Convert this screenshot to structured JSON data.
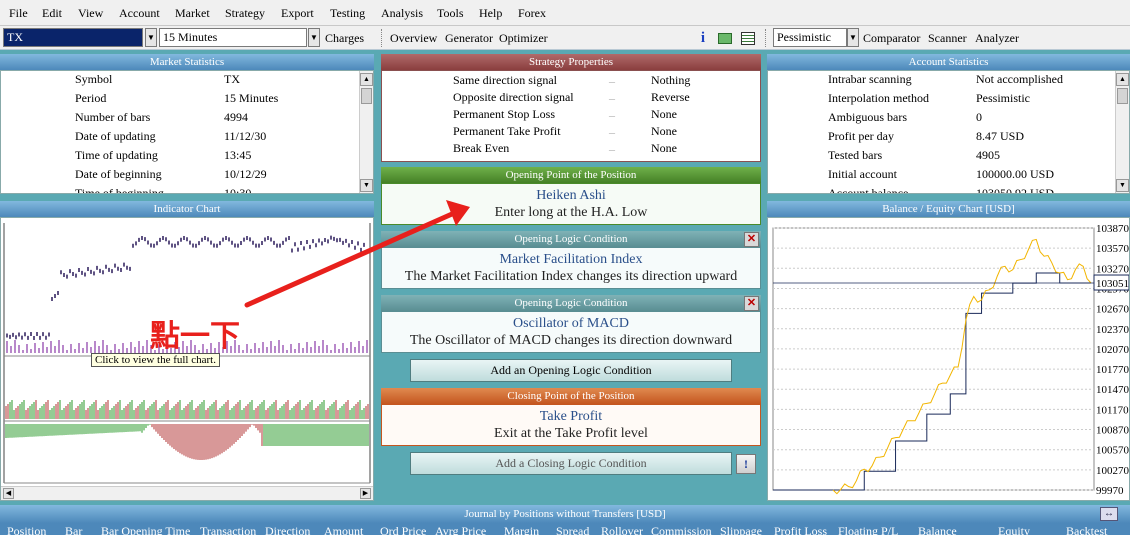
{
  "menu": [
    "File",
    "Edit",
    "View",
    "Account",
    "Market",
    "Strategy",
    "Export",
    "Testing",
    "Analysis",
    "Tools",
    "Help",
    "Forex"
  ],
  "toolbar": {
    "symbol": "TX",
    "period": "15 Minutes",
    "charges": "Charges",
    "overview": "Overview",
    "generator": "Generator",
    "optimizer": "Optimizer",
    "interpolation": "Pessimistic",
    "comparator": "Comparator",
    "scanner": "Scanner",
    "analyzer": "Analyzer"
  },
  "market_statistics": {
    "title": "Market Statistics",
    "rows": [
      {
        "label": "Symbol",
        "value": "TX"
      },
      {
        "label": "Period",
        "value": "15 Minutes"
      },
      {
        "label": "Number of bars",
        "value": "4994"
      },
      {
        "label": "Date of updating",
        "value": "11/12/30"
      },
      {
        "label": "Time of updating",
        "value": "13:45"
      },
      {
        "label": "Date of beginning",
        "value": "10/12/29"
      },
      {
        "label": "Time of beginning",
        "value": "10:30"
      }
    ]
  },
  "strategy_properties": {
    "title": "Strategy Properties",
    "dash": "_",
    "rows": [
      {
        "label": "Same direction signal",
        "value": "Nothing"
      },
      {
        "label": "Opposite direction signal",
        "value": "Reverse"
      },
      {
        "label": "Permanent Stop Loss",
        "value": "None"
      },
      {
        "label": "Permanent Take Profit",
        "value": "None"
      },
      {
        "label": "Break Even",
        "value": "None"
      }
    ]
  },
  "account_statistics": {
    "title": "Account Statistics",
    "rows": [
      {
        "label": "Intrabar scanning",
        "value": "Not accomplished"
      },
      {
        "label": "Interpolation method",
        "value": "Pessimistic"
      },
      {
        "label": "Ambiguous bars",
        "value": "0"
      },
      {
        "label": "Profit per day",
        "value": "8.47 USD"
      },
      {
        "label": "Tested bars",
        "value": "4905"
      },
      {
        "label": "Initial account",
        "value": "100000.00 USD"
      },
      {
        "label": "Account balance",
        "value": "103050.92 USD"
      }
    ]
  },
  "indicator_chart": {
    "title": "Indicator Chart",
    "tooltip": "Click to view the full chart."
  },
  "opening_point": {
    "title": "Opening Point of the Position",
    "name": "Heiken Ashi",
    "desc": "Enter long at the H.A. Low"
  },
  "opening_logic_1": {
    "title": "Opening Logic Condition",
    "name": "Market Facilitation Index",
    "desc": "The Market Facilitation Index changes its direction upward"
  },
  "opening_logic_2": {
    "title": "Opening Logic Condition",
    "name": "Oscillator of MACD",
    "desc": "The Oscillator of MACD changes its direction downward"
  },
  "add_opening": "Add an Opening Logic Condition",
  "closing_point": {
    "title": "Closing Point of the Position",
    "name": "Take Profit",
    "desc": "Exit at the Take Profit level"
  },
  "add_closing": "Add a Closing Logic Condition",
  "help_glyph": "!",
  "close_glyph": "✕",
  "annotation": {
    "text": "點一下",
    "color": "#e8201c"
  },
  "balance_chart": {
    "title": "Balance / Equity Chart [USD]",
    "current_value": "103051"
  },
  "chart_data": {
    "type": "line",
    "title": "Balance / Equity Chart [USD]",
    "y_ticks": [
      103870,
      103570,
      103270,
      102970,
      102670,
      102370,
      102070,
      101770,
      101470,
      101170,
      100870,
      100570,
      100270,
      99970
    ],
    "ylim": [
      99970,
      103870
    ],
    "marker_value": 103051,
    "series": [
      {
        "color": "#f2b500",
        "values": [
          99970,
          99980,
          100020,
          100110,
          100280,
          100330,
          100460,
          100600,
          100750,
          100880,
          101000,
          101120,
          101260,
          101400,
          101560,
          101680,
          101800,
          102500,
          102850,
          102800,
          102950,
          103150,
          103300,
          103250,
          103400,
          103550,
          103700,
          103450,
          103350,
          103200,
          103100,
          103250,
          103300,
          103051
        ]
      },
      {
        "color": "#1a2a5a",
        "values": [
          99970,
          99970,
          99970,
          99970,
          100250,
          100250,
          100250,
          100250,
          100700,
          100700,
          100700,
          100700,
          101100,
          101100,
          101100,
          101400,
          101400,
          102600,
          102600,
          102900,
          102900,
          102900,
          102900,
          103050,
          103050,
          103050,
          103200,
          103200,
          103200,
          103051,
          103051,
          103051,
          103051,
          103051
        ]
      }
    ]
  },
  "journal": {
    "title": "Journal by Positions without Transfers [USD]",
    "columns": [
      "Position",
      "Bar",
      "Bar Opening Time",
      "Transaction",
      "Direction",
      "Amount",
      "Ord Price",
      "Avrg Price",
      "Margin",
      "Spread",
      "Rollover",
      "Commission",
      "Slippage",
      "Profit Loss",
      "Floating P/L",
      "Balance",
      "Equity",
      "Backtest"
    ]
  }
}
